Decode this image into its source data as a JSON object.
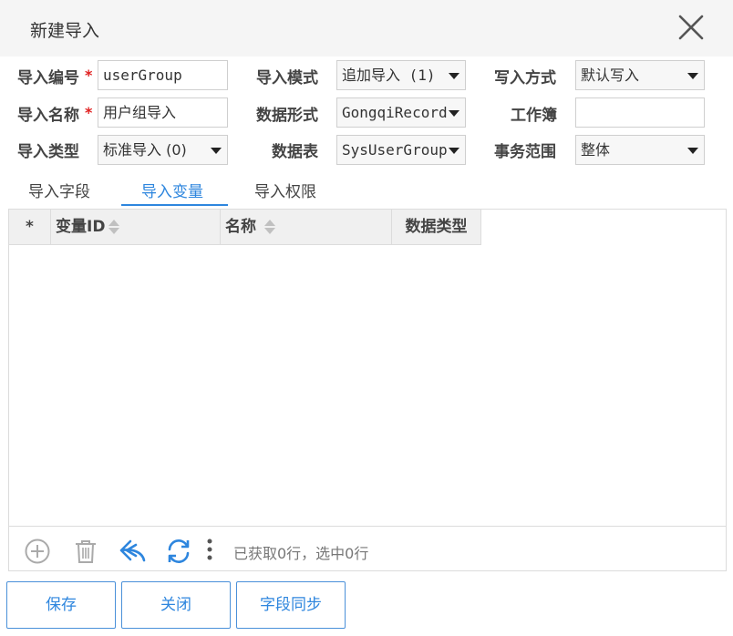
{
  "dialog": {
    "title": "新建导入"
  },
  "form": {
    "import_code": {
      "label": "导入编号",
      "required_mark": "*",
      "value": "userGroup"
    },
    "import_name": {
      "label": "导入名称",
      "required_mark": "*",
      "value": "用户组导入"
    },
    "import_type": {
      "label": "导入类型",
      "value": "标准导入 (0)"
    },
    "import_mode": {
      "label": "导入模式",
      "value": "追加导入 (1)"
    },
    "data_format": {
      "label": "数据形式",
      "value": "GongqiRecord"
    },
    "data_table": {
      "label": "数据表",
      "value": "SysUserGroup"
    },
    "write_method": {
      "label": "写入方式",
      "value": "默认写入"
    },
    "workbook": {
      "label": "工作簿",
      "value": ""
    },
    "transaction_scope": {
      "label": "事务范围",
      "value": "整体"
    }
  },
  "tabs": [
    {
      "label": "导入字段",
      "active": false
    },
    {
      "label": "导入变量",
      "active": true
    },
    {
      "label": "导入权限",
      "active": false
    }
  ],
  "grid": {
    "columns": [
      "*",
      "变量ID",
      "名称",
      "数据类型"
    ],
    "rows": [],
    "status_text": "已获取0行，选中0行",
    "toolbar_icons": [
      "add-icon",
      "delete-icon",
      "undo-icon",
      "refresh-icon",
      "more-icon"
    ]
  },
  "buttons": {
    "save": "保存",
    "close": "关闭",
    "sync": "字段同步"
  },
  "colors": {
    "accent": "#2e86de",
    "required": "#e02020",
    "titlebar": "#f5f5f5"
  }
}
